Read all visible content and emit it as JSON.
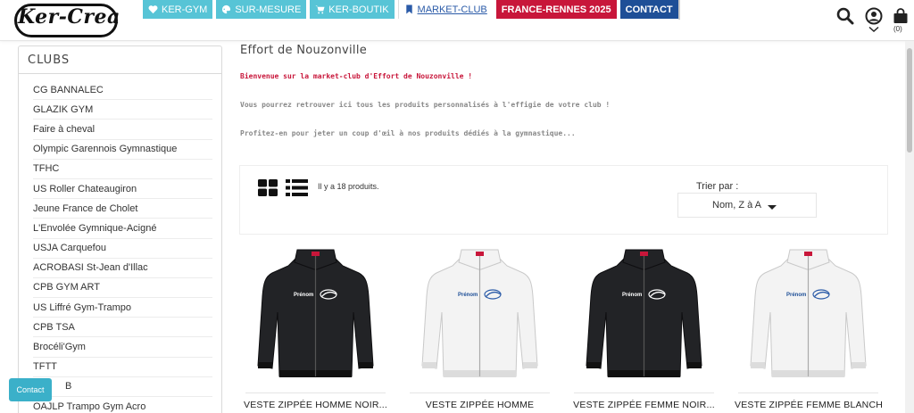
{
  "brand": {
    "name": "Ker-Crea"
  },
  "nav": [
    {
      "label": "KER-GYM",
      "icon": "heart-icon"
    },
    {
      "label": "SUR-MESURE",
      "icon": "palette-icon"
    },
    {
      "label": "KER-BOUTIK",
      "icon": "cart-icon"
    },
    {
      "label": "MARKET-CLUB",
      "icon": "bookmark-icon"
    },
    {
      "label": "FRANCE-RENNES 2025"
    },
    {
      "label": "CONTACT"
    }
  ],
  "header": {
    "cart_count": "(0)"
  },
  "sidebar": {
    "title": "CLUBS",
    "items": [
      "CG BANNALEC",
      "GLAZIK GYM",
      "Faire à cheval",
      "Olympic Garennois Gymnastique",
      "TFHC",
      "US Roller Chateaugiron",
      "Jeune France de Cholet",
      "L'Envolée Gymnique-Acigné",
      "USJA Carquefou",
      "ACROBASI St-Jean d'Illac",
      "CPB GYM ART",
      "US Liffré Gym-Trampo",
      "CPB TSA",
      "Brocéli'Gym",
      "TFTT",
      "B",
      "OAJLP Trampo Gym Acro"
    ]
  },
  "page": {
    "title": "Effort de Nouzonville",
    "welcome": "Bienvenue sur la market-club d'Effort de Nouzonville !",
    "line2": "Vous pourrez retrouver ici tous les produits personnalisés à l'effigie de votre club !",
    "line3": "Profitez-en pour jeter un coup d'œil à nos produits dédiés à la gymnastique..."
  },
  "listing": {
    "count_text": "Il y a 18 produits.",
    "sort_label": "Trier par :",
    "sort_value": "Nom, Z à A"
  },
  "products": [
    {
      "name": "VESTE ZIPPÉE HOMME NOIR...",
      "color": "#222326",
      "print": "Prénom"
    },
    {
      "name": "VESTE ZIPPÉE HOMME",
      "color": "#f3f3f3",
      "print": "Prénom"
    },
    {
      "name": "VESTE ZIPPÉE FEMME NOIR...",
      "color": "#222326",
      "print": "Prénom"
    },
    {
      "name": "VESTE ZIPPÉE FEMME BLANCHE...",
      "color": "#f3f3f3",
      "print": "Prénom"
    }
  ],
  "contact_button": {
    "label": "Contact"
  },
  "colors": {
    "accent_cyan": "#57c4d6",
    "red": "#c8163a",
    "blue": "#1e4f97",
    "link": "#2b5ba8"
  }
}
